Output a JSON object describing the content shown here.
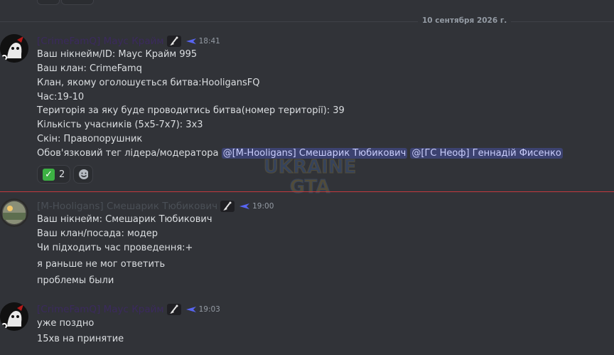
{
  "date_divider": "10 сентября 2026 г.",
  "messages": [
    {
      "author": "[CrimeFamQ] Маус Крайм",
      "time": "18:41",
      "lines": [
        "Ваш нікнейм/ID: Маус Крайм 995",
        "Ваш клан: CrimeFamq",
        "Клан, якому оголошується битва:HooligansFQ",
        "Час:19-10",
        "Територія за яку буде проводитись битва(номер території): 39",
        "Кількість учасників (5х5-7х7): 3х3",
        "Скін: Правопорушник"
      ],
      "last_line_text": "Обов'язковий тег лідера/модератора ",
      "mentions": [
        "@[M-Hooligans] Смешарик Тюбикович",
        "@[ГС Неоф] Геннадій Фисенко"
      ],
      "reaction_count": "2"
    },
    {
      "author": "[M-Hooligans] Смешарик Тюбикович",
      "time": "19:00",
      "lines": [
        "Ваш нікнейм: Смешарик Тюбикович",
        "Ваш клан/посада: модер",
        "Чи підходить час проведення:+",
        "я раньше не мог ответить",
        "проблемы были"
      ]
    },
    {
      "author": "[CrimeFamQ] Маус Крайм",
      "time": "19:03",
      "lines": [
        "уже поздно",
        "15хв на принятие"
      ]
    }
  ],
  "watermark": [
    "UKRAINE",
    "GTA"
  ],
  "colors": {
    "background": "#313338",
    "mention_bg": "#3c4270",
    "new_divider": "#c23a3f",
    "check": "#3cb043"
  }
}
